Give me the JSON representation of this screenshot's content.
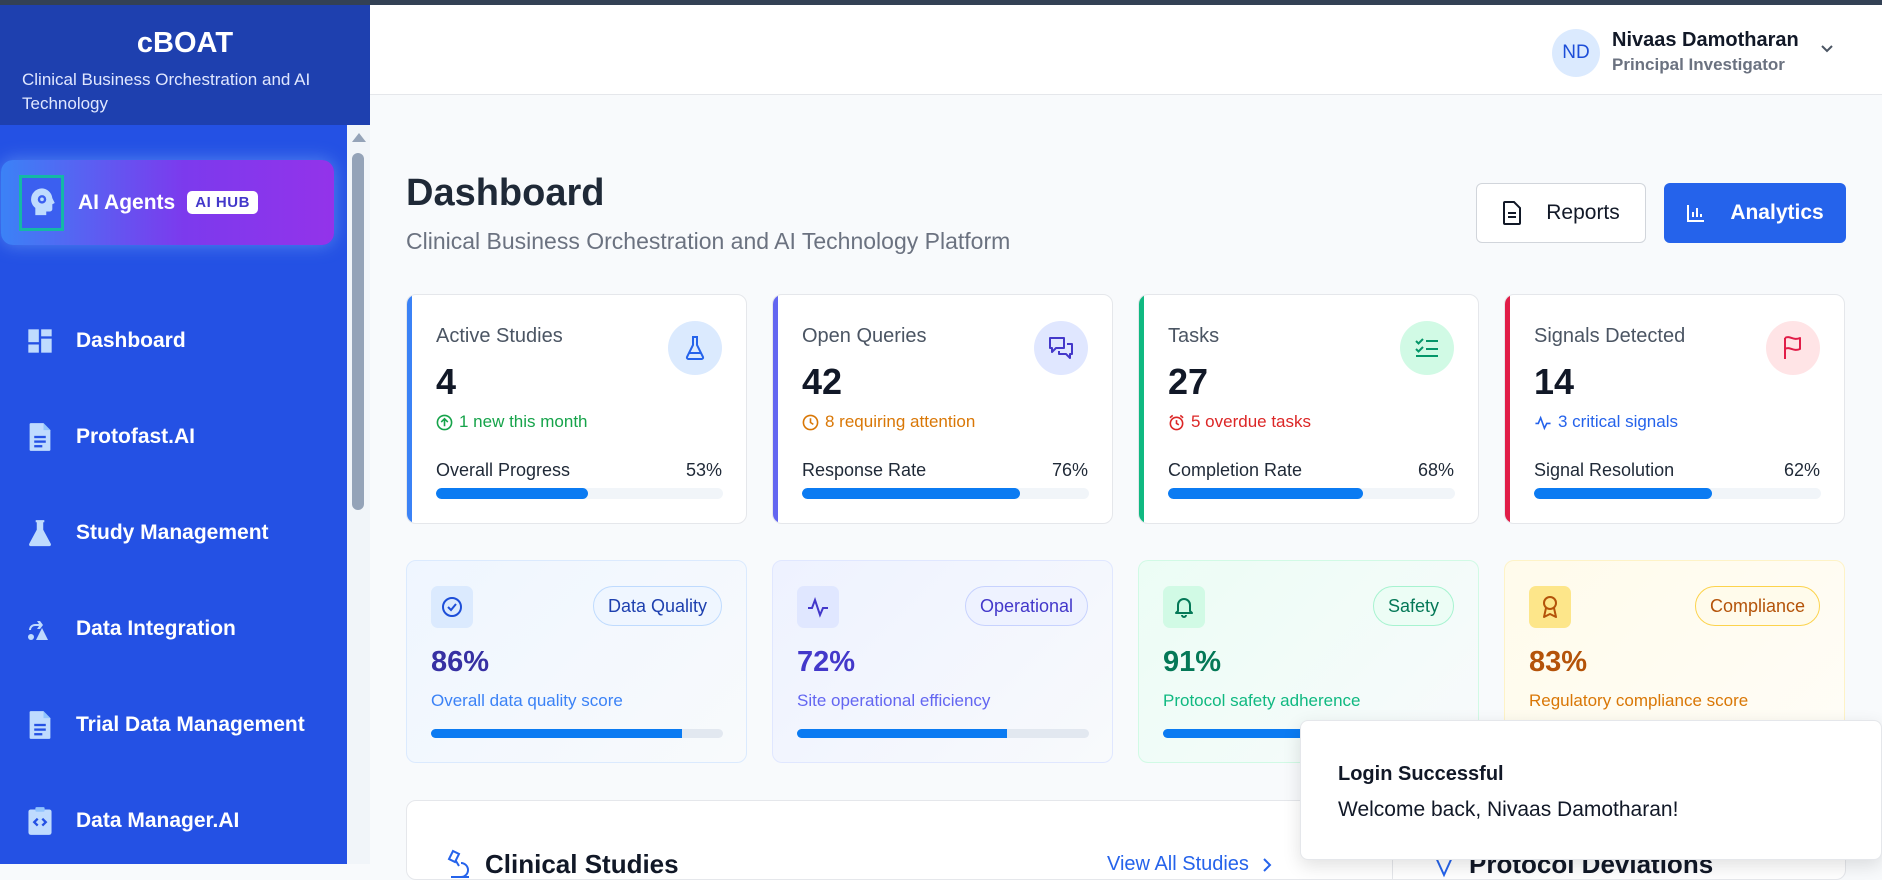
{
  "brand": {
    "title": "cBOAT",
    "subtitle": "Clinical Business Orchestration and AI Technology"
  },
  "sidebar": {
    "ai_item": {
      "label": "AI Agents",
      "badge": "AI HUB"
    },
    "items": [
      {
        "label": "Dashboard",
        "icon": "dashboard-icon"
      },
      {
        "label": "Protofast.AI",
        "icon": "document-icon"
      },
      {
        "label": "Study Management",
        "icon": "flask-icon"
      },
      {
        "label": "Data Integration",
        "icon": "integration-icon"
      },
      {
        "label": "Trial Data Management",
        "icon": "document-icon"
      },
      {
        "label": "Data Manager.AI",
        "icon": "clipboard-code-icon"
      }
    ]
  },
  "user": {
    "initials": "ND",
    "name": "Nivaas Damotharan",
    "role": "Principal Investigator"
  },
  "page": {
    "title": "Dashboard",
    "subtitle": "Clinical Business Orchestration and AI Technology Platform",
    "reports_label": "Reports",
    "analytics_label": "Analytics"
  },
  "stats": [
    {
      "label": "Active Studies",
      "value": "4",
      "note": "1 new this month",
      "progress_label": "Overall Progress",
      "progress_pct": "53%",
      "progress": 0.53,
      "accent": "#3b82f6",
      "note_color": "#16a34a",
      "icon": "flask-icon"
    },
    {
      "label": "Open Queries",
      "value": "42",
      "note": "8 requiring attention",
      "progress_label": "Response Rate",
      "progress_pct": "76%",
      "progress": 0.76,
      "accent": "#6366f1",
      "note_color": "#d97706",
      "icon": "chat-icon"
    },
    {
      "label": "Tasks",
      "value": "27",
      "note": "5 overdue tasks",
      "progress_label": "Completion Rate",
      "progress_pct": "68%",
      "progress": 0.68,
      "accent": "#10b981",
      "note_color": "#dc2626",
      "icon": "checklist-icon"
    },
    {
      "label": "Signals Detected",
      "value": "14",
      "note": "3 critical signals",
      "progress_label": "Signal Resolution",
      "progress_pct": "62%",
      "progress": 0.62,
      "accent": "#e11d48",
      "note_color": "#2563eb",
      "icon": "flag-icon"
    }
  ],
  "metrics": [
    {
      "tag": "Data Quality",
      "value": "86%",
      "desc": "Overall data quality score",
      "progress": 0.86,
      "color": "#3730a3",
      "desc_color": "#3b82f6",
      "icon": "check-circle-icon"
    },
    {
      "tag": "Operational",
      "value": "72%",
      "desc": "Site operational efficiency",
      "progress": 0.72,
      "color": "#4338ca",
      "desc_color": "#6366f1",
      "icon": "activity-icon"
    },
    {
      "tag": "Safety",
      "value": "91%",
      "desc": "Protocol safety adherence",
      "progress": 0.91,
      "color": "#047857",
      "desc_color": "#10b981",
      "icon": "bell-icon"
    },
    {
      "tag": "Compliance",
      "value": "83%",
      "desc": "Regulatory compliance score",
      "progress": 0.83,
      "color": "#b45309",
      "desc_color": "#d97706",
      "icon": "award-icon"
    }
  ],
  "sections": {
    "clinical_studies": "Clinical Studies",
    "view_all": "View All Studies",
    "protocol_deviations": "Protocol Deviations"
  },
  "toast": {
    "title": "Login Successful",
    "message": "Welcome back, Nivaas Damotharan!"
  }
}
